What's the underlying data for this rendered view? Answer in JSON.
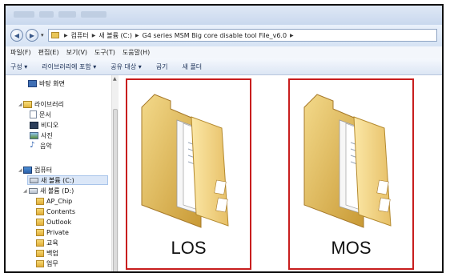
{
  "address": {
    "segments": [
      "컴퓨터",
      "새 볼륨 (C:)",
      "G4 series MSM Big core disable tool File_v6.0"
    ]
  },
  "menu": [
    "파일(F)",
    "편집(E)",
    "보기(V)",
    "도구(T)",
    "도움말(H)"
  ],
  "toolbar": {
    "organize": "구성 ▾",
    "include": "라이브러리에 포함 ▾",
    "share": "공유 대상 ▾",
    "burn": "굽기",
    "new_folder": "새 폴더"
  },
  "sidebar": {
    "desktop": "바탕 화면",
    "libraries": "라이브러리",
    "documents": "문서",
    "videos": "비디오",
    "pictures": "사진",
    "music": "음악",
    "computer": "컴퓨터",
    "drive_c": "새 볼륨 (C:)",
    "drive_d": "새 볼륨 (D:)",
    "folders": [
      "AP_Chip",
      "Contents",
      "Outlook",
      "Private",
      "교육",
      "백업",
      "업무"
    ]
  },
  "files": [
    {
      "name": "LOS"
    },
    {
      "name": "MOS"
    }
  ]
}
